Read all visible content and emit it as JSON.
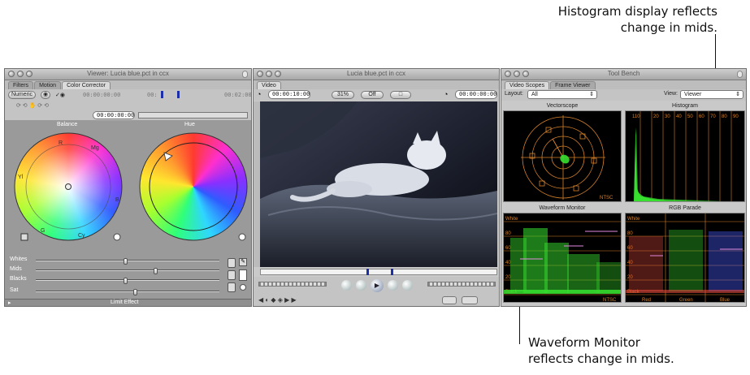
{
  "callouts": {
    "top_line1": "Histogram display reflects",
    "top_line2": "change in mids.",
    "bottom_line1": "Waveform Monitor",
    "bottom_line2": "reflects change in mids."
  },
  "viewer_window": {
    "title": "Viewer: Lucia blue.pct in ccx",
    "tabs": [
      "Filters",
      "Motion",
      "Color Corrector"
    ],
    "active_tab": "Color Corrector",
    "numeric_button": "Numeric",
    "timecode_start": "00:00:00:00",
    "timecode_mid": "00:",
    "timecode_end": "00:02:00:",
    "playhead_timecode": "00:00:00:00",
    "balance_label": "Balance",
    "hue_label": "Hue",
    "wheel_labels": {
      "r": "R",
      "mg": "Mg",
      "yl": "Yl",
      "b": "B",
      "g": "G",
      "cy": "Cy"
    },
    "sliders": [
      {
        "label": "Whites",
        "value": 0.48
      },
      {
        "label": "Mids",
        "value": 0.64
      },
      {
        "label": "Blacks",
        "value": 0.48
      },
      {
        "label": "Sat",
        "value": 0.53
      }
    ],
    "limit_effect": "Limit Effect"
  },
  "canvas_window": {
    "title": "Lucia blue.pct in ccx",
    "tab": "Video",
    "timecode_left": "00:00:10:00",
    "zoom": "31%",
    "overlay": "Off",
    "timecode_right": "00:00:00:00"
  },
  "toolbench_window": {
    "title": "Tool Bench",
    "tabs": [
      "Video Scopes",
      "Frame Viewer"
    ],
    "active_tab": "Video Scopes",
    "layout_label": "Layout:",
    "layout_value": "All",
    "view_label": "View:",
    "view_value": "Viewer",
    "vectorscope_title": "Vectorscope",
    "histogram_title": "Histogram",
    "waveform_title": "Waveform Monitor",
    "rgb_parade_title": "RGB Parade",
    "ntsc": "NTSC",
    "white_label": "White",
    "black_label": "Black",
    "waveform_scale": [
      "80",
      "60",
      "40",
      "20"
    ],
    "histogram_scale": [
      "110",
      "20",
      "30",
      "40",
      "50",
      "60",
      "70",
      "80",
      "90"
    ],
    "parade_channels": [
      "Red",
      "Green",
      "Blue"
    ]
  },
  "colors": {
    "scope_orange": "#d8822a",
    "scope_green": "#37e02f",
    "window_gray": "#c9c9c9"
  }
}
